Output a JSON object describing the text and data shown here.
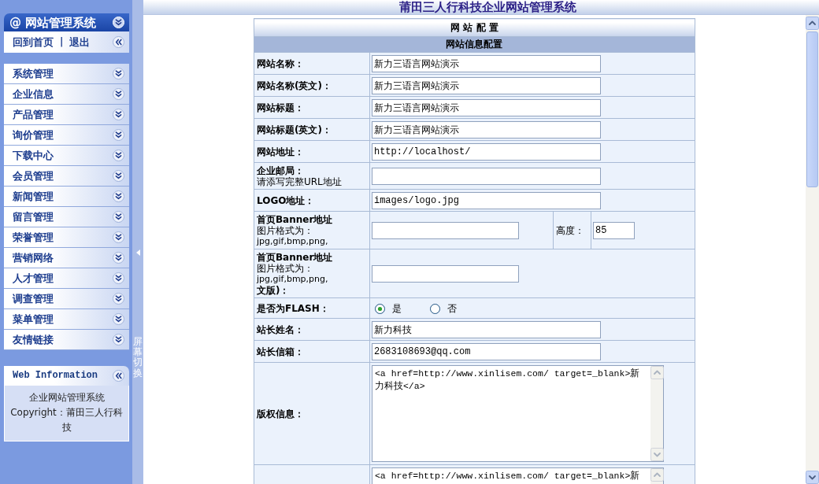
{
  "sidebar": {
    "title": "@ 网站管理系统",
    "quick_links": [
      "回到首页",
      "退出"
    ],
    "link_separator": "|",
    "menu": [
      {
        "label": "系统管理",
        "expanded": false
      },
      {
        "label": "企业信息",
        "expanded": false
      },
      {
        "label": "产品管理",
        "expanded": false
      },
      {
        "label": "询价管理",
        "expanded": false
      },
      {
        "label": "下载中心",
        "expanded": false
      },
      {
        "label": "会员管理",
        "expanded": false
      },
      {
        "label": "新闻管理",
        "expanded": false
      },
      {
        "label": "留言管理",
        "expanded": false
      },
      {
        "label": "荣誉管理",
        "expanded": false
      },
      {
        "label": "营销网络",
        "expanded": false
      },
      {
        "label": "人才管理",
        "expanded": false
      },
      {
        "label": "调查管理",
        "expanded": false
      },
      {
        "label": "菜单管理",
        "expanded": false
      },
      {
        "label": "友情链接",
        "expanded": false
      }
    ],
    "info_panel": {
      "title": "Web Information",
      "lines": [
        "企业网站管理系统",
        "Copyright：莆田三人行科技"
      ]
    }
  },
  "splitter": {
    "label": "屏幕切换"
  },
  "header": {
    "title": "莆田三人行科技企业网站管理系统"
  },
  "form": {
    "title": "网 站 配 置",
    "section": "网站信息配置",
    "rows": [
      {
        "kind": "input",
        "label": "网站名称：",
        "value": "新力三语言网站演示"
      },
      {
        "kind": "input",
        "label": "网站名称(英文)：",
        "value": "新力三语言网站演示"
      },
      {
        "kind": "input",
        "label": "网站标题：",
        "value": "新力三语言网站演示"
      },
      {
        "kind": "input",
        "label": "网站标题(英文)：",
        "value": "新力三语言网站演示"
      },
      {
        "kind": "input",
        "label": "网站地址：",
        "value": "http://localhost/"
      },
      {
        "kind": "input",
        "label": "企业邮局：",
        "notes": [
          "请添写完整URL地址"
        ]
      },
      {
        "kind": "input",
        "label": "LOGO地址：",
        "value": "images/logo.jpg"
      },
      {
        "kind": "banner",
        "label": "首页Banner地址",
        "notes": [
          "图片格式为：",
          "jpg,gif,bmp,png,"
        ],
        "height_label": "高度：",
        "height_value": "85"
      },
      {
        "kind": "banner",
        "label": "首页Banner地址",
        "notes": [
          "图片格式为：",
          "jpg,gif,bmp,png,"
        ],
        "label_tail": "文版)："
      },
      {
        "kind": "radio",
        "label": "是否为FLASH：",
        "options": [
          {
            "label": "是",
            "selected": true
          },
          {
            "label": "否",
            "selected": false
          }
        ]
      },
      {
        "kind": "input",
        "label": "站长姓名：",
        "value": "新力科技"
      },
      {
        "kind": "input",
        "label": "站长信箱：",
        "value": "2683108693@qq.com"
      },
      {
        "kind": "textarea",
        "label": "版权信息：",
        "value": "<a href=http://www.xinlisem.com/ target=_blank>新力科技</a>"
      },
      {
        "kind": "textarea",
        "value": "<a href=http://www.xinlisem.com/ target=_blank>新"
      }
    ]
  }
}
